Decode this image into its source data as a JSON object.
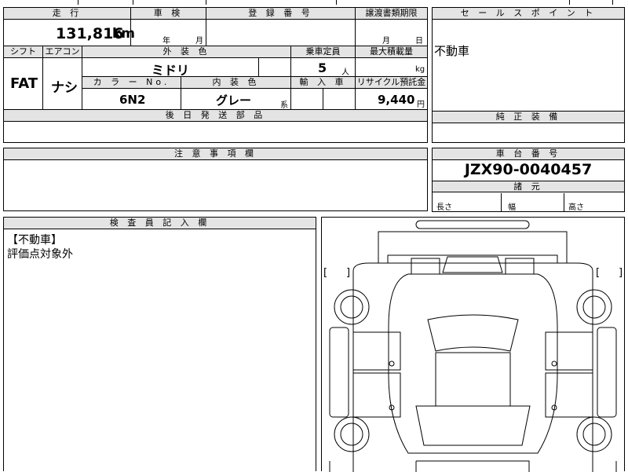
{
  "headers": {
    "mileage": "走 行",
    "inspection": "車 検",
    "registration": "登 録 番 号",
    "transfer_docs": "譲渡書類期限",
    "sales_point": "セ ー ル ス ポ イ ン ト",
    "shift": "シフト",
    "aircon": "エアコン",
    "exterior_color": "外 装 色",
    "capacity": "乗車定員",
    "max_load": "最大積載量",
    "color_no": "カ ラ ー No.",
    "interior_color": "内 装 色",
    "import": "輸 入 車",
    "recycle": "リサイクル預託金",
    "rear_parts": "後 日 発 送 部 品",
    "genuine_equipment": "純 正 装 備",
    "notes": "注 意 事 項 欄",
    "chassis_no": "車 台 番 号",
    "dimensions": "諸 元",
    "inspector_notes": "検 査 員 記 入 欄"
  },
  "values": {
    "mileage": "131,816",
    "mileage_unit": "km",
    "inspection_year": "年",
    "inspection_month": "月",
    "transfer_month": "月",
    "transfer_day": "日",
    "sales_point": "不動車",
    "shift": "FAT",
    "aircon": "ナシ",
    "exterior_color": "ミドリ",
    "capacity": "5",
    "capacity_unit": "人",
    "max_load_unit": "kg",
    "color_no": "6N2",
    "interior_color": "グレー",
    "interior_suffix": "系",
    "recycle": "9,440",
    "recycle_unit": "円",
    "chassis_no": "JZX90-0040457",
    "length_label": "長さ",
    "width_label": "幅",
    "height_label": "高さ",
    "inspector_line1": "【不動車】",
    "inspector_line2": "評価点対象外",
    "bracket_open": "[",
    "bracket_close": "]"
  }
}
